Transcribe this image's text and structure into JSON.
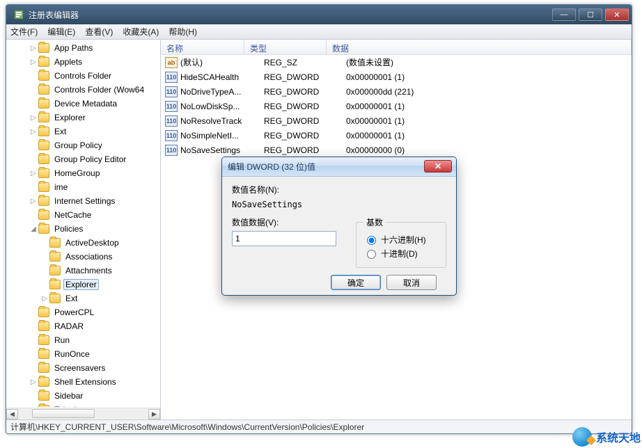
{
  "window": {
    "title": "注册表编辑器",
    "min": "—",
    "max": "☐",
    "close": "✕"
  },
  "menu": {
    "file": "文件(F)",
    "edit": "编辑(E)",
    "view": "查看(V)",
    "fav": "收藏夹(A)",
    "help": "帮助(H)"
  },
  "tree": [
    {
      "indent": 2,
      "exp": "▷",
      "label": "App Paths"
    },
    {
      "indent": 2,
      "exp": "▷",
      "label": "Applets"
    },
    {
      "indent": 2,
      "exp": "",
      "label": "Controls Folder"
    },
    {
      "indent": 2,
      "exp": "",
      "label": "Controls Folder (Wow64"
    },
    {
      "indent": 2,
      "exp": "",
      "label": "Device Metadata"
    },
    {
      "indent": 2,
      "exp": "▷",
      "label": "Explorer"
    },
    {
      "indent": 2,
      "exp": "▷",
      "label": "Ext"
    },
    {
      "indent": 2,
      "exp": "",
      "label": "Group Policy"
    },
    {
      "indent": 2,
      "exp": "",
      "label": "Group Policy Editor"
    },
    {
      "indent": 2,
      "exp": "▷",
      "label": "HomeGroup"
    },
    {
      "indent": 2,
      "exp": "",
      "label": "ime"
    },
    {
      "indent": 2,
      "exp": "▷",
      "label": "Internet Settings"
    },
    {
      "indent": 2,
      "exp": "",
      "label": "NetCache"
    },
    {
      "indent": 2,
      "exp": "◢",
      "label": "Policies"
    },
    {
      "indent": 3,
      "exp": "",
      "label": "ActiveDesktop"
    },
    {
      "indent": 3,
      "exp": "",
      "label": "Associations"
    },
    {
      "indent": 3,
      "exp": "",
      "label": "Attachments"
    },
    {
      "indent": 3,
      "exp": "",
      "label": "Explorer",
      "selected": true
    },
    {
      "indent": 3,
      "exp": "▷",
      "label": "Ext"
    },
    {
      "indent": 2,
      "exp": "",
      "label": "PowerCPL"
    },
    {
      "indent": 2,
      "exp": "",
      "label": "RADAR"
    },
    {
      "indent": 2,
      "exp": "",
      "label": "Run"
    },
    {
      "indent": 2,
      "exp": "",
      "label": "RunOnce"
    },
    {
      "indent": 2,
      "exp": "",
      "label": "Screensavers"
    },
    {
      "indent": 2,
      "exp": "▷",
      "label": "Shell Extensions"
    },
    {
      "indent": 2,
      "exp": "",
      "label": "Sidebar"
    },
    {
      "indent": 2,
      "exp": "▷",
      "label": "Telephony"
    }
  ],
  "list": {
    "columns": {
      "name": "名称",
      "type": "类型",
      "data": "数据"
    },
    "rows": [
      {
        "icon": "ab",
        "name": "(默认)",
        "type": "REG_SZ",
        "data": "(数值未设置)"
      },
      {
        "icon": "bin",
        "name": "HideSCAHealth",
        "type": "REG_DWORD",
        "data": "0x00000001 (1)"
      },
      {
        "icon": "bin",
        "name": "NoDriveTypeA...",
        "type": "REG_DWORD",
        "data": "0x000000dd (221)"
      },
      {
        "icon": "bin",
        "name": "NoLowDiskSp...",
        "type": "REG_DWORD",
        "data": "0x00000001 (1)"
      },
      {
        "icon": "bin",
        "name": "NoResolveTrack",
        "type": "REG_DWORD",
        "data": "0x00000001 (1)"
      },
      {
        "icon": "bin",
        "name": "NoSimpleNetI...",
        "type": "REG_DWORD",
        "data": "0x00000001 (1)"
      },
      {
        "icon": "bin",
        "name": "NoSaveSettings",
        "type": "REG_DWORD",
        "data": "0x00000000 (0)"
      }
    ]
  },
  "dialog": {
    "title": "编辑 DWORD (32 位)值",
    "name_label": "数值名称(N):",
    "name_value": "NoSaveSettings",
    "data_label": "数值数据(V):",
    "data_value": "1",
    "base_label": "基数",
    "hex": "十六进制(H)",
    "dec": "十进制(D)",
    "ok": "确定",
    "cancel": "取消"
  },
  "status": "计算机\\HKEY_CURRENT_USER\\Software\\Microsoft\\Windows\\CurrentVersion\\Policies\\Explorer",
  "watermark": "系统天地"
}
